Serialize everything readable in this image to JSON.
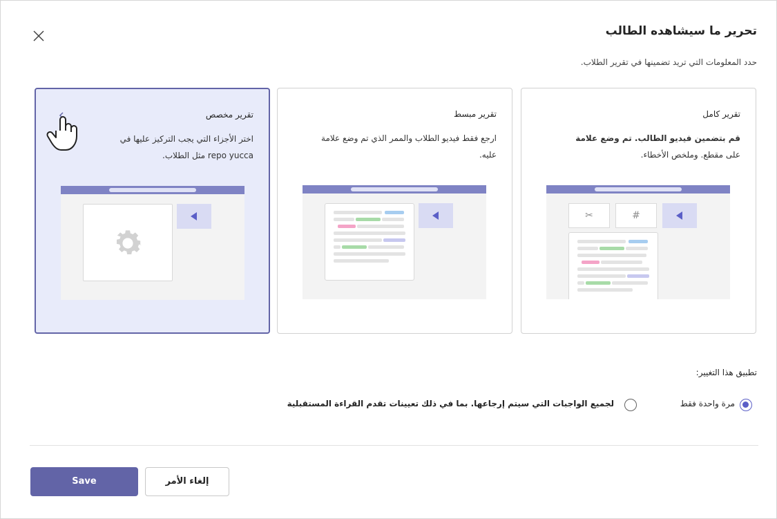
{
  "dialog": {
    "title": "تحرير ما سيشاهده الطالب",
    "subtitle": "حدد المعلومات التي تريد تضمينها في تقرير الطلاب.",
    "close_icon": "close-icon"
  },
  "cards": {
    "full": {
      "title": "تقرير كامل",
      "desc_bold": "قم بتضمين فيديو الطالب. تم وضع علامة",
      "desc_rest": "على مقطع. وملخص الأخطاء.",
      "tile_icons": [
        "wand-icon",
        "hash-icon",
        "play-icon"
      ]
    },
    "simple": {
      "title": "تقرير مبسط",
      "desc": "ارجع فقط فيديو الطلاب والممر الذي تم وضع علامة عليه."
    },
    "custom": {
      "title": "تقرير مخصص",
      "desc": "اختر الأجزاء التي يجب التركيز عليها في repo yucca مثل الطلاب.",
      "icons": [
        "hand-pointer-icon",
        "gear-icon"
      ]
    },
    "selected": "custom"
  },
  "apply": {
    "label": "تطبيق هذا التغيير:",
    "options": [
      {
        "label": "مرة واحدة فقط",
        "checked": true
      },
      {
        "label": "لجميع الواجبات التي سيتم إرجاعها. بما في ذلك تعيينات تقدم القراءة المستقبلية",
        "checked": false
      }
    ]
  },
  "buttons": {
    "save": "Save",
    "cancel": "إلغاء الأمر"
  },
  "colors": {
    "accent": "#6264a7",
    "selected_bg": "#e8ebfa"
  }
}
